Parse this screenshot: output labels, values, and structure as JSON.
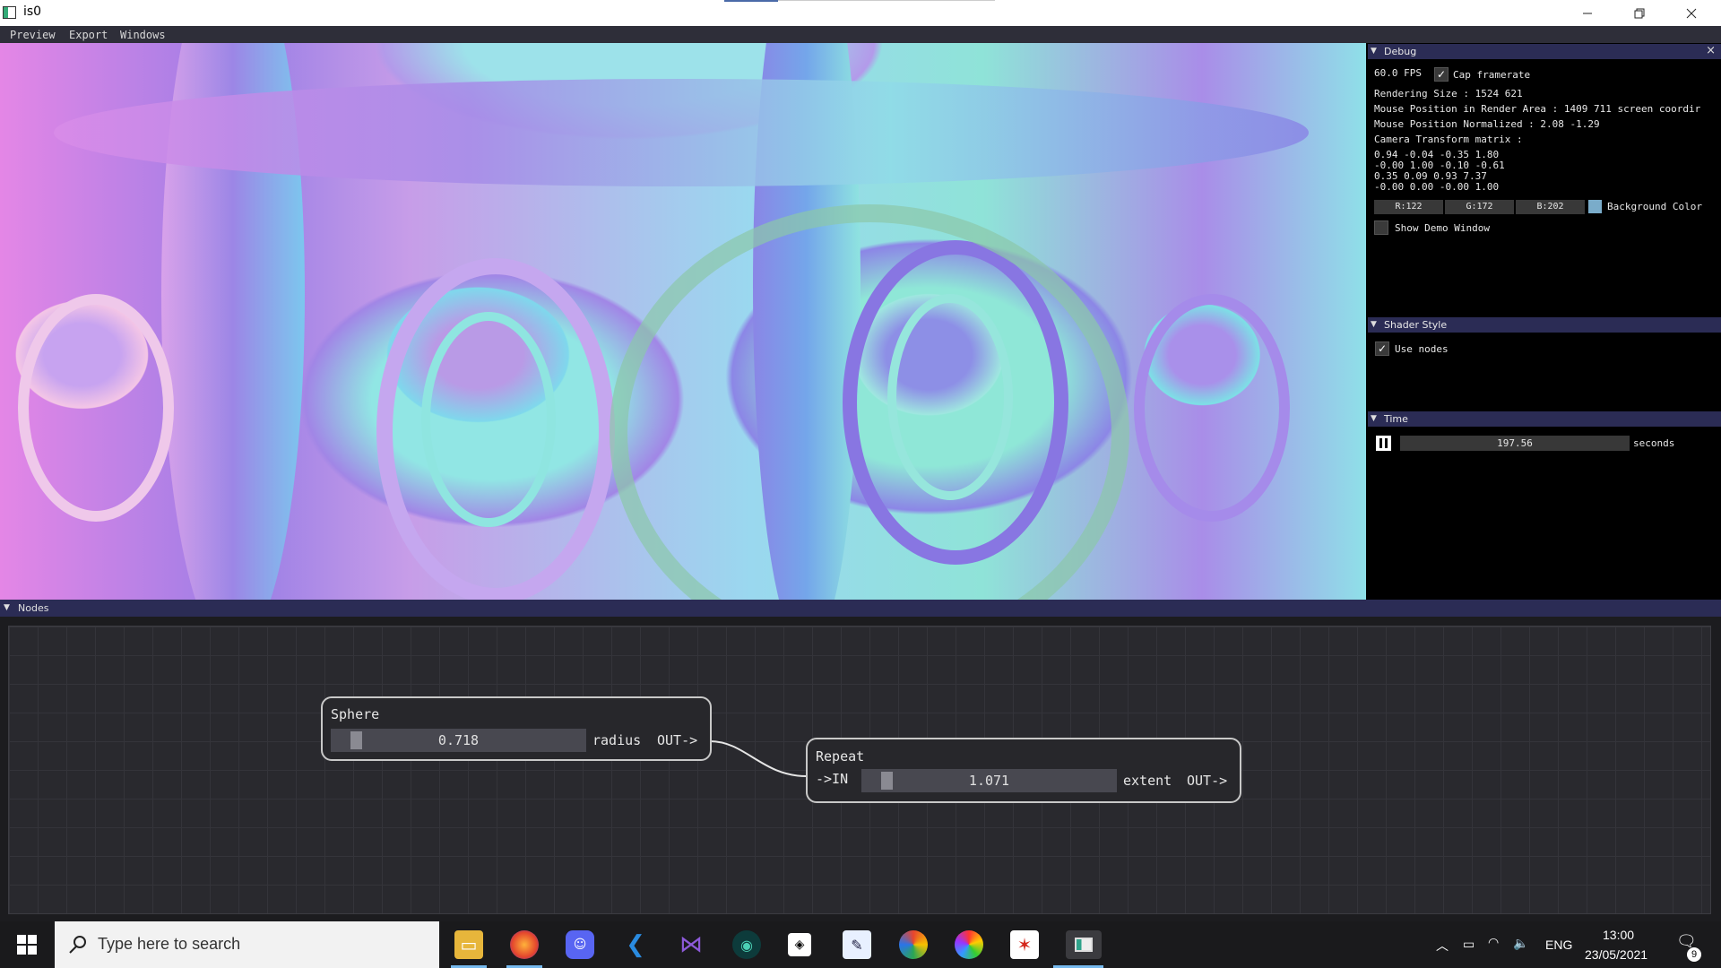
{
  "window": {
    "title": "is0",
    "minimize_icon": "minimize-icon",
    "maximize_icon": "restore-icon",
    "close_icon": "close-icon"
  },
  "menubar": {
    "items": [
      "Preview",
      "Export",
      "Windows"
    ]
  },
  "debug": {
    "title": "Debug",
    "fps": "60.0 FPS",
    "cap_framerate_label": "Cap framerate",
    "cap_framerate_checked": true,
    "rendering_size": "Rendering Size : 1524 621",
    "mouse_position": "Mouse Position in Render Area : 1409 711 screen coordir",
    "mouse_normalized": "Mouse Position Normalized : 2.08 -1.29",
    "camera_label": "Camera Transform matrix :",
    "matrix_rows": [
      "0.94 -0.04 -0.35 1.80",
      "-0.00 1.00 -0.10 -0.61",
      "0.35 0.09 0.93 7.37",
      "-0.00 0.00 -0.00 1.00"
    ],
    "bg_r": "R:122",
    "bg_g": "G:172",
    "bg_b": "B:202",
    "bg_color_hex": "#7aacca",
    "bg_color_label": "Background Color",
    "show_demo_label": "Show Demo Window",
    "show_demo_checked": false
  },
  "shader_style": {
    "title": "Shader Style",
    "use_nodes_label": "Use nodes",
    "use_nodes_checked": true
  },
  "time": {
    "title": "Time",
    "value": "197.56",
    "unit": "seconds",
    "pause_icon": "pause-icon"
  },
  "nodes": {
    "title": "Nodes",
    "sphere": {
      "title": "Sphere",
      "value": "0.718",
      "fraction": 0.08,
      "param": "radius",
      "out": "OUT->"
    },
    "repeat": {
      "title": "Repeat",
      "in": "->IN",
      "value": "1.071",
      "fraction": 0.08,
      "param": "extent",
      "out": "OUT->"
    }
  },
  "taskbar": {
    "search_placeholder": "Type here to search",
    "language": "ENG",
    "time": "13:00",
    "date": "23/05/2021",
    "notification_count": "9",
    "apps": [
      "file-explorer-icon",
      "firefox-icon",
      "discord-icon",
      "vscode-icon",
      "visual-studio-icon",
      "gitkraken-icon",
      "unity-icon",
      "paint-icon",
      "chrome-canary-icon",
      "aperture-icon",
      "acrobat-icon",
      "is0-app-icon"
    ]
  }
}
